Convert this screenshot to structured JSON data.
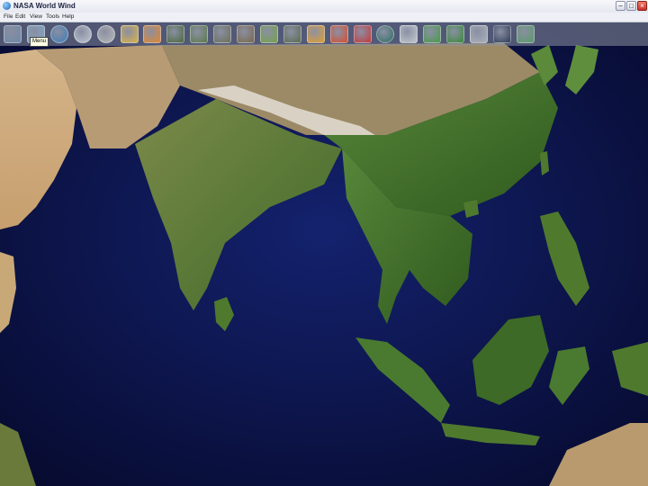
{
  "window": {
    "title": "NASA World Wind",
    "minimize_glyph": "–",
    "maximize_glyph": "□",
    "close_glyph": "×"
  },
  "menu": [
    "File",
    "Edit",
    "View",
    "Tools",
    "Help"
  ],
  "toolbar": {
    "tooltip": "Menu",
    "buttons": [
      {
        "name": "menu-button-icon",
        "color": "#6e8aa8",
        "round": false
      },
      {
        "name": "globe-sphere-icon",
        "color": "#7fa7c9",
        "round": false
      },
      {
        "name": "earth-globe-icon",
        "color": "#3d7fb8",
        "round": true
      },
      {
        "name": "search-icon",
        "color": "#bcc6d2",
        "round": true
      },
      {
        "name": "moon-globe-icon",
        "color": "#b8b8b8",
        "round": true
      },
      {
        "name": "topography-layer-icon",
        "color": "#d8b24a",
        "round": false
      },
      {
        "name": "temperature-layer-icon",
        "color": "#e2872e",
        "round": false
      },
      {
        "name": "landsat-layer-icon",
        "color": "#4c6a3c",
        "round": false
      },
      {
        "name": "imagery-layer-icon",
        "color": "#5c7a4a",
        "round": false
      },
      {
        "name": "elevation-layer-icon",
        "color": "#6a7058",
        "round": false
      },
      {
        "name": "terrain-layer-icon",
        "color": "#7a6848",
        "round": false
      },
      {
        "name": "landcover-layer-icon",
        "color": "#74a24a",
        "round": false
      },
      {
        "name": "satellite-layer-icon",
        "color": "#5b6b50",
        "round": false
      },
      {
        "name": "weather-layer-icon",
        "color": "#e0a030",
        "round": false
      },
      {
        "name": "fires-layer-icon",
        "color": "#d4502e",
        "round": false
      },
      {
        "name": "us-flag-layer-icon",
        "color": "#c23a3a",
        "round": false
      },
      {
        "name": "place-names-icon",
        "color": "#2f6e62",
        "round": true
      },
      {
        "name": "boundaries-layer-icon",
        "color": "#c2c7cc",
        "round": false
      },
      {
        "name": "grid-layer-icon",
        "color": "#4a9a4a",
        "round": false
      },
      {
        "name": "vegetation-layer-icon",
        "color": "#3a8a3a",
        "round": false
      },
      {
        "name": "scale-layer-icon",
        "color": "#a9b0b8",
        "round": false
      },
      {
        "name": "compass-layer-icon",
        "color": "#2e3e58",
        "round": false
      },
      {
        "name": "atmosphere-layer-icon",
        "color": "#5a9a6a",
        "round": false
      }
    ]
  },
  "colors": {
    "ocean": "#0a1048",
    "desert": "#c9a878",
    "forest": "#4f7a2e",
    "mountains": "#9a8a6c"
  }
}
